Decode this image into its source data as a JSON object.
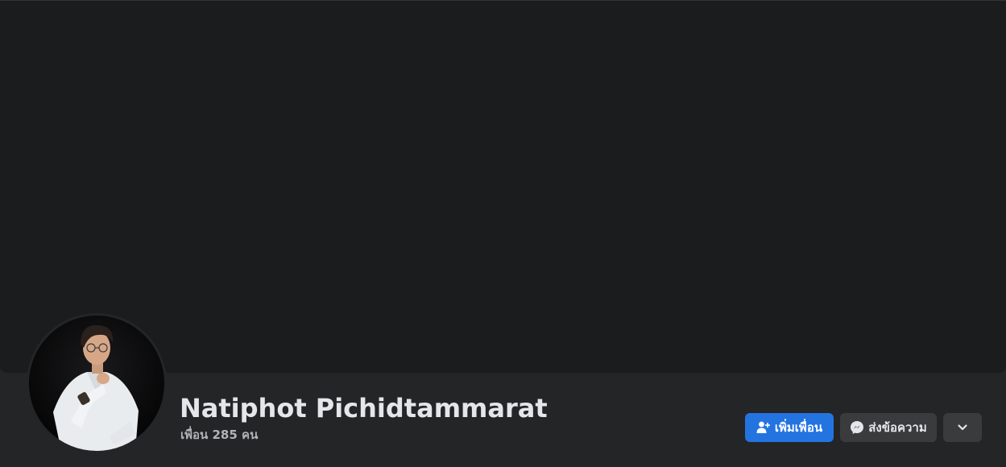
{
  "profile": {
    "name": "Natiphot Pichidtammarat",
    "friends_text": "เพื่อน 285 คน"
  },
  "actions": {
    "add_friend_label": "เพิ่มเพื่อน",
    "message_label": "ส่งข้อความ",
    "add_friend_icon": "add-friend-icon",
    "message_icon": "messenger-icon",
    "more_icon": "chevron-down-icon"
  },
  "colors": {
    "page_bg": "#242526",
    "cover_bg": "#1b1c1e",
    "primary_button": "#2374e1",
    "secondary_button": "#3a3b3c",
    "primary_text": "#e4e6eb",
    "secondary_text": "#b0b3b8"
  }
}
